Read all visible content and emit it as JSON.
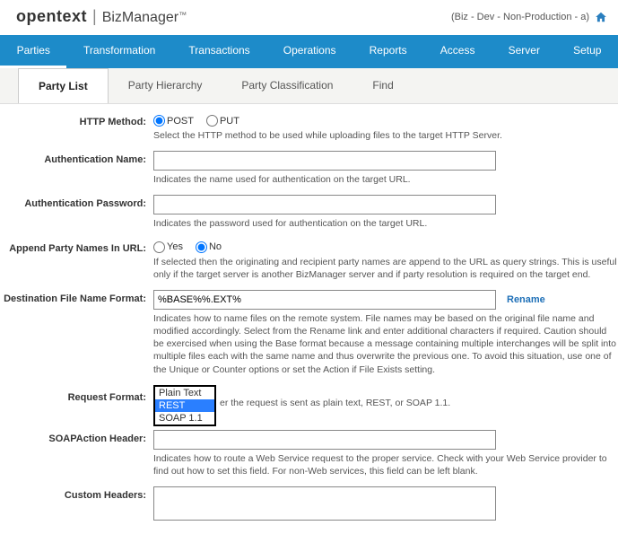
{
  "brand": {
    "ot": "opentext",
    "bm": "BizManager",
    "tm": "™"
  },
  "env": "(Biz - Dev - Non-Production - a)",
  "mainNav": [
    "Parties",
    "Transformation",
    "Transactions",
    "Operations",
    "Reports",
    "Access",
    "Server",
    "Setup"
  ],
  "subNav": [
    "Party List",
    "Party Hierarchy",
    "Party Classification",
    "Find"
  ],
  "form": {
    "httpMethod": {
      "label": "HTTP Method:",
      "opts": [
        "POST",
        "PUT"
      ],
      "hint": "Select the HTTP method to be used while uploading files to the target HTTP Server."
    },
    "authName": {
      "label": "Authentication Name:",
      "value": "",
      "hint": "Indicates the name used for authentication on the target URL."
    },
    "authPass": {
      "label": "Authentication Password:",
      "value": "",
      "hint": "Indicates the password used for authentication on the target URL."
    },
    "appendNames": {
      "label": "Append Party Names In URL:",
      "opts": [
        "Yes",
        "No"
      ],
      "hint": "If selected then the originating and recipient party names are append to the URL as query strings. This is useful only if the target server is another BizManager server and if party resolution is required on the target end."
    },
    "destFmt": {
      "label": "Destination File Name Format:",
      "value": "%BASE%%.EXT%",
      "rename": "Rename",
      "hint": "Indicates how to name files on the remote system. File names may be based on the original file name and modified accordingly. Select from the Rename link and enter additional characters if required. Caution should be exercised when using the Base format because a message containing multiple interchanges will be split into multiple files each with the same name and thus overwrite the previous one. To avoid this situation, use one of the Unique or Counter options or set the Action if File Exists setting."
    },
    "reqFmt": {
      "label": "Request Format:",
      "opts": [
        "Plain Text",
        "REST",
        "SOAP 1.1"
      ],
      "hint": "er the request is sent as plain text, REST, or SOAP 1.1."
    },
    "soapAction": {
      "label": "SOAPAction Header:",
      "value": "",
      "hint": "Indicates how to route a Web Service request to the proper service. Check with your Web Service provider to find out how to set this field. For non-Web services, this field can be left blank."
    },
    "customHdr": {
      "label": "Custom Headers:",
      "value": ""
    }
  }
}
